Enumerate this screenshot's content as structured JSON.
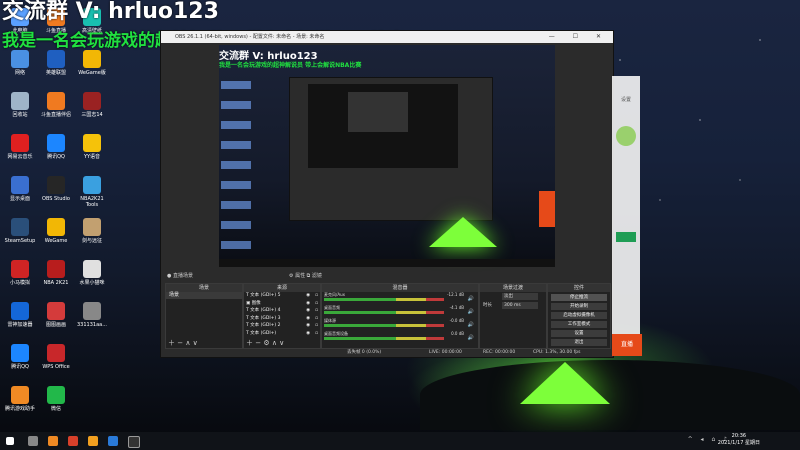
{
  "overlay": {
    "line1": "交流群 V: hrluo123",
    "line2": "我是一名会玩游戏的超神解说员 带上会解说NBA比赛"
  },
  "desktop_icons": [
    {
      "label": "此电脑",
      "color": "#5aa0ff"
    },
    {
      "label": "网络",
      "color": "#4a90e2"
    },
    {
      "label": "回收站",
      "color": "#9fb4c8"
    },
    {
      "label": "网易云音乐",
      "color": "#e02020"
    },
    {
      "label": "显示桌面",
      "color": "#3a6fd0"
    },
    {
      "label": "SteamSetup",
      "color": "#2a4f7a"
    },
    {
      "label": "小马模拟",
      "color": "#d02424"
    },
    {
      "label": "雷神加速器",
      "color": "#1467d8"
    },
    {
      "label": "腾讯QQ",
      "color": "#1c86ff"
    },
    {
      "label": "腾讯游戏助手",
      "color": "#f08a24"
    },
    {
      "label": "斗鱼直播",
      "color": "#f07a20"
    },
    {
      "label": "英雄联盟",
      "color": "#1f5fc0"
    },
    {
      "label": "斗鱼直播伴侣",
      "color": "#f07a20"
    },
    {
      "label": "腾讯QQ",
      "color": "#1c86ff"
    },
    {
      "label": "OBS Studio",
      "color": "#262626"
    },
    {
      "label": "WeGame",
      "color": "#f2b705"
    },
    {
      "label": "NBA 2K21",
      "color": "#b81d1d"
    },
    {
      "label": "图图画画",
      "color": "#d43b3b"
    },
    {
      "label": "WPS Office",
      "color": "#c8272a"
    },
    {
      "label": "微信",
      "color": "#22b84a"
    },
    {
      "label": "高清壁纸",
      "color": "#19c0b0"
    },
    {
      "label": "WeGame版",
      "color": "#f2b705"
    },
    {
      "label": "三国志14",
      "color": "#9a2222"
    },
    {
      "label": "YY语音",
      "color": "#f5c20a"
    },
    {
      "label": "NBA2K21 Tools",
      "color": "#3aa0e0"
    },
    {
      "label": "剑与远征",
      "color": "#c2a070"
    },
    {
      "label": "水果小猫咪",
      "color": "#e0e0e0"
    },
    {
      "label": "331131aa...",
      "color": "#888888"
    }
  ],
  "obs": {
    "title": "OBS 26.1.1 (64-bit, windows) - 配置文件: 未命名 - 场景: 未命名",
    "window_controls": "— ☐ ✕",
    "preview_overlay_1": "交流群 V: hrluo123",
    "preview_overlay_2": "我是一名会玩游戏的超神解说员 带上会解说NBA比赛",
    "toolbar_left": "● 直播场景",
    "toolbar_mid": "⚙ 属性    ⧉ 滤镜",
    "docks": {
      "scenes": {
        "header": "场景",
        "items": [
          "场景"
        ]
      },
      "sources": {
        "header": "来源",
        "items": [
          "T  文本 (GDI+) 5",
          "▣  图像",
          "T  文本 (GDI+) 4",
          "T  文本 (GDI+) 3",
          "T  文本 (GDI+) 2",
          "T  文本 (GDI+)"
        ]
      },
      "mixer": {
        "header": "混音器",
        "channels": [
          {
            "name": "麦克风/Aux",
            "db": "-12.1 dB"
          },
          {
            "name": "桌面音频",
            "db": "-4.1 dB"
          },
          {
            "name": "媒体源",
            "db": "-0.0 dB"
          },
          {
            "name": "桌面音频设备",
            "db": "0.0 dB"
          }
        ]
      },
      "transitions": {
        "header": "场景过渡",
        "type_label": "淡出",
        "duration_label": "时长",
        "duration_value": "300 ms"
      },
      "controls": {
        "header": "控件",
        "buttons": [
          "停止推流",
          "开始录制",
          "启动虚拟摄像机",
          "工作室模式",
          "设置",
          "退出"
        ]
      }
    },
    "status": {
      "live": "LIVE: 00:00:00",
      "rec": "REC: 00:00:00",
      "cpu": "CPU: 1.3%, 30.00 fps",
      "dropped": "丢失帧 0 (0.0%)"
    }
  },
  "right_panel": {
    "caption": "设置",
    "button": "直播"
  },
  "taskbar": {
    "time": "20:36",
    "date": "2021/1/17 星期日"
  }
}
